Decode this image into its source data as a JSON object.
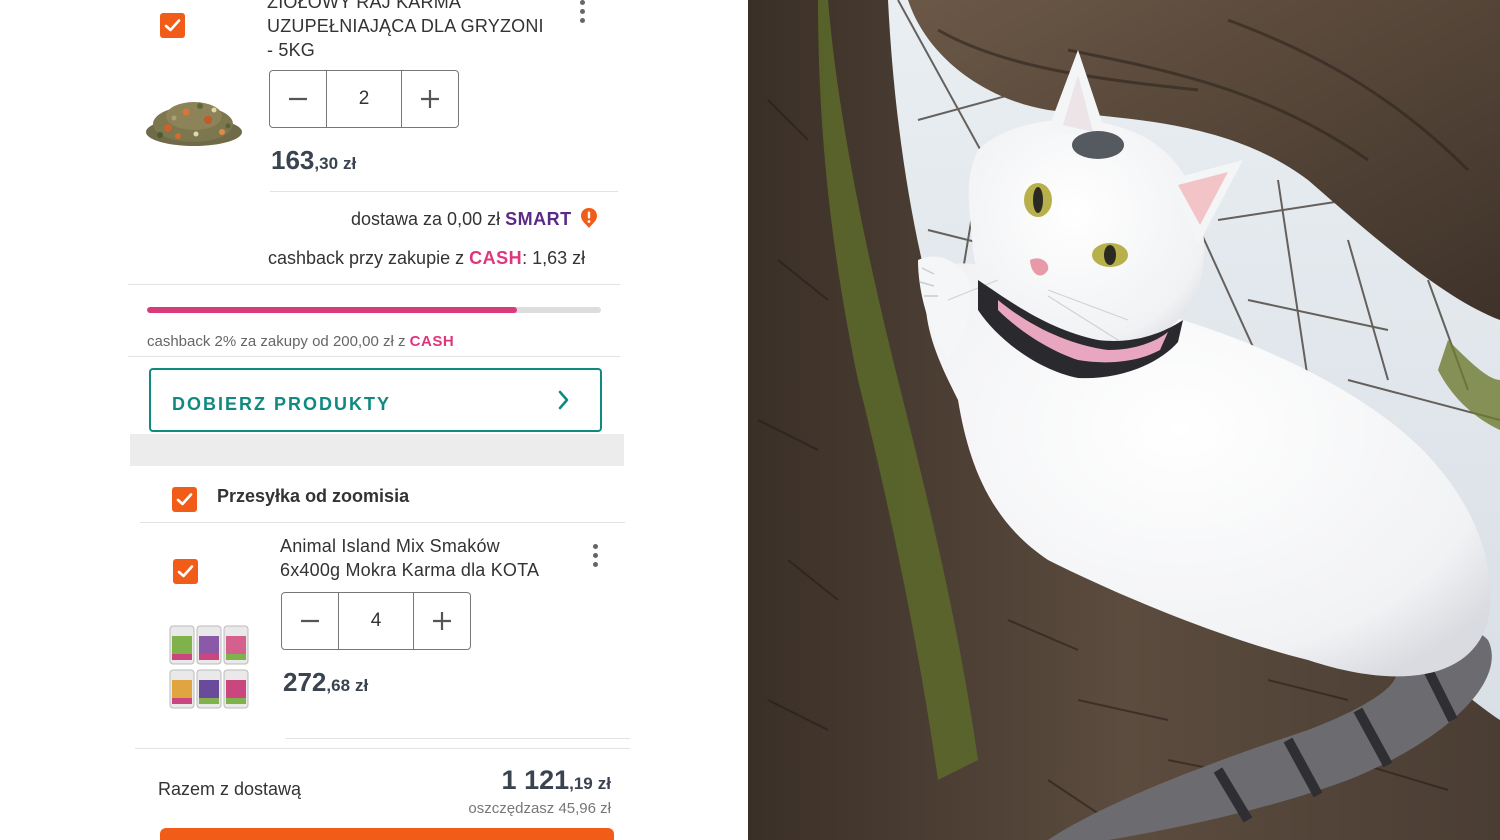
{
  "cart": {
    "item1": {
      "title_line1": "ZIOŁOWY RAJ KARMA",
      "title_line2": "UZUPEŁNIAJĄCA DLA GRYZONI",
      "title_line3": "- 5KG",
      "quantity": "2",
      "price_int": "163",
      "price_dec": ",30",
      "currency": "zł",
      "checked": true
    },
    "delivery": {
      "text": "dostawa za 0,00 zł",
      "smart_label": "SMART"
    },
    "cashback_line": {
      "prefix": "cashback przy zakupie z",
      "cash_label": "CASH",
      "suffix": ": 1,63 zł"
    },
    "cashback_progress": {
      "fraction": 0.816,
      "text": "cashback 2% za zakupy od 200,00 zł z",
      "cash_label": "CASH",
      "bar_color": "#d93a7a"
    },
    "dobierz_button": {
      "label": "DOBIERZ PRODUKTY"
    },
    "shipment": {
      "label": "Przesyłka od zoomisia",
      "checked": true
    },
    "item2": {
      "title_line1": "Animal Island Mix Smaków",
      "title_line2": "6x400g Mokra Karma dla KOTA",
      "quantity": "4",
      "price_int": "272",
      "price_dec": ",68",
      "currency": "zł",
      "checked": true
    },
    "summary": {
      "label": "Razem z dostawą",
      "total_int": "1 121",
      "total_dec": ",19",
      "currency": "zł",
      "savings": "oszczędzasz 45,96 zł"
    }
  },
  "colors": {
    "accent_orange": "#f25c19",
    "teal": "#0f8a80",
    "smart_purple": "#5b2a86",
    "cash_pink": "#e0347d"
  },
  "icons": [
    "checkbox-checked-icon",
    "kebab-menu-icon",
    "minus-icon",
    "plus-icon",
    "chevron-right-icon",
    "smart-exclamation-icon"
  ]
}
